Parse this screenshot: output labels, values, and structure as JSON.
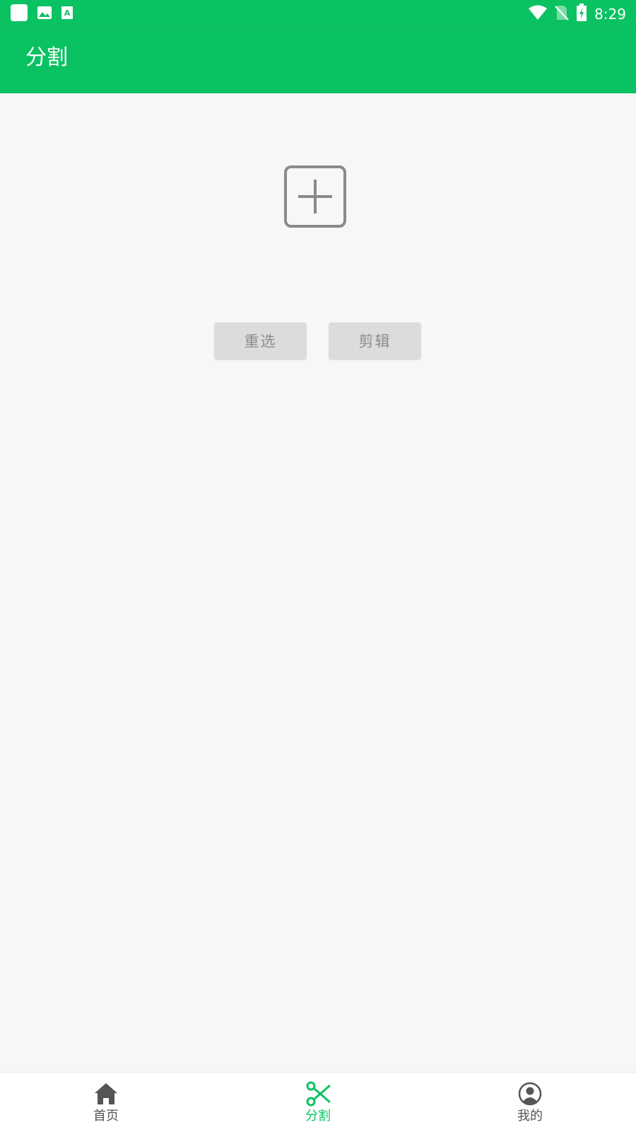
{
  "status_bar": {
    "time": "8:29",
    "left_icons": [
      "app-icon",
      "image-icon",
      "text-icon"
    ],
    "right_icons": [
      "wifi-icon",
      "no-sim-icon",
      "battery-charging-icon"
    ]
  },
  "app_bar": {
    "title": "分割"
  },
  "main": {
    "add_icon": "plus-square-icon",
    "buttons": {
      "reselect": "重选",
      "edit": "剪辑"
    }
  },
  "bottom_nav": {
    "items": [
      {
        "label": "首页",
        "icon": "home-icon",
        "active": false
      },
      {
        "label": "分割",
        "icon": "scissors-icon",
        "active": true
      },
      {
        "label": "我的",
        "icon": "user-icon",
        "active": false
      }
    ]
  },
  "colors": {
    "primary": "#0ac262",
    "background": "#f7f7f7",
    "button_bg": "#dcdcdc",
    "button_text": "#8c8c8c",
    "inactive_nav": "#555555"
  }
}
